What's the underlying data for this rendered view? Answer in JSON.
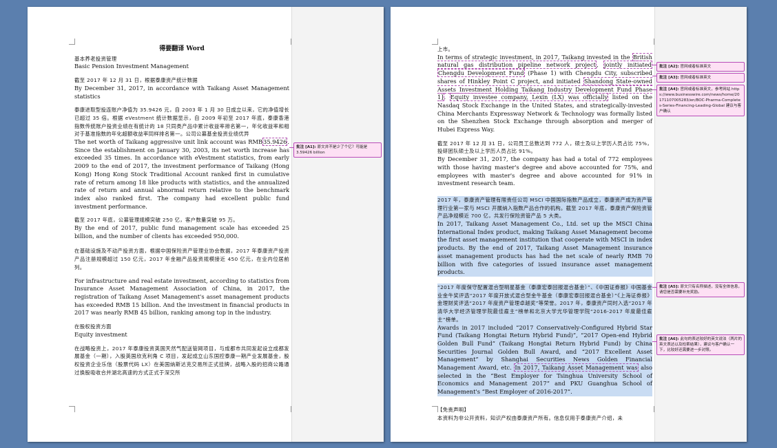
{
  "page1": {
    "title": "得要翻译 Word",
    "block1_cn": "基本养老投资管理",
    "block1_en": "Basic Pension Investment Management",
    "block2_cn": "截至 2017 年 12 月 31 日，根据泰康资产统计数据",
    "block2_en": "By December 31, 2017, in accordance with Taikang Asset Management statistics",
    "block3_cn": "泰康进取型投连账户净值为 35.9426 元，自 2003 年 1 月 30 日成立以来，它的净值增长已超过 35 倍。根据 eVestment 统计数据显示，自 2009 年初至 2017 年底，泰康香港指数传统账户投资业绩在有统计的 18 只同类产品中累计收益率排名第一，年化收益率和相对于基准指数的年化超额收益率同样排名第一。公司公募基金投资业绩优异",
    "block3_en_pre": "The net worth of Taikang aggressive unit link account was RMB",
    "block3_en_mark": "35.9426",
    "block3_en_post": ". Since the establishment on January 30, 2003, its net worth increase has exceeded 35 times. In accordance with eVestment statistics, from early 2009 to the end of 2017, the investment performance of Taikang (Hong Kong) Hong Kong Stock Traditional Account ranked first in cumulative rate of return among 18 like products with statistics, and the annualized rate of return and annual abnormal return relative to the benchmark index also ranked first. The company had excellent public fund investment performance.",
    "block4_cn": "截至 2017 年底，公募管理规模突破 250 亿，客户数量突破 95 万。",
    "block4_en": "By the end of 2017, public fund management scale has exceeded 25 billion, and the number of clients has exceeded 950,000.",
    "block5_cn": "在基础设施及不动产投资方面，根据中国保险资产管理业协会数据，2017 年泰康资产投资产品注册规模超过 150 亿元，2017 年金融产品投资规模接近 450 亿元，在业内位居前列。",
    "block5_en": "For infrastructure and real estate investment, according to statistics from Insurance Asset Management Association of China, in 2017, the registration of Taikang Asset Management's asset management products has exceeded RMB 15 billion. And the investment in financial products in 2017 was nearly RMB 45 billion, ranking among top in the industry.",
    "block6_cn": "在股权投资方面",
    "block6_en": "Equity investment",
    "block7_cn": "在战略投资上，2017 年泰康投资英国天然气配送管网项目，与成都市共同发起设立成都发展基金（一期），入股英国欣克利角 C 项目，发起成立山东国控泰康一期产业发展基金，股权投资企业乐信（股票代码 LX）在美国纳斯达克交易所正式挂牌，战略入股的招商公路通过换股吸收合并湖北高速的方式正式于深交所"
  },
  "page2": {
    "p1_cn": "上市。",
    "p1_en_a": "In terms of strategic investment, in 2017, Taikang invested in the ",
    "p1_en_mark1": "British natural gas distribution pipeline network project",
    "p1_en_b": ", ",
    "p1_en_mark2": "jointly initiated",
    "p1_en_c": " ",
    "p1_en_mark3": "Chengdu Development Fund",
    "p1_en_d": " (Phase 1) with Chengdu City, subscribed shares of Hinkley Point C project, and initiated ",
    "p1_en_mark4": "Shandong State-owned Assets Investment Holding Taikang Industry Development Fund Phase 1]",
    "p1_en_e": ". ",
    "p1_en_mark5": "Equity investee company, Lexin (LX) was officially",
    "p1_en_f": " listed on the Nasdaq Stock Exchange in the United States, and strategically-invested China Merchants Expressway Network & Technology was formally listed on the Shenzhen Stock Exchange through absorption and merger of Hubei Express Way.",
    "p2_cn": "截至 2017 年 12 月 31 日，公司员工总数达到 772 人，硕士及以上学历人员占比 75%，投研团队硕士及以上学历人员占比 91%。",
    "p2_en": "By December 31, 2017, the company has had a total of 772 employees with those having master's degree and above accounted for 75%, and employees with master's degree and above accounted for 91% in investment research team.",
    "p3_cn": "2017 年，泰康资产管理有限责任公司 MSCI 中国国际指数产品成立，泰康资产成为资产管理行业第一家与 MSCI 开展纳入指数产品合作的机构。截至 2017 年底，泰康资产保险资管产品净规模近 700 亿，共发行保险资管产品 5 大类。",
    "p3_en": "In 2017, Taikang Asset Management Co., Ltd. set up the MSCI China International Index product, making Taikang Asset Management become the first asset management institution that cooperate with MSCI in index products. By the end of 2017, Taikang Asset Management insurance asset management products has had the net scale of nearly RMB 70 billion with five categories of issued insurance asset management products.",
    "p4_cn": "“2017 年度保守配置混合型明星基金（泰康宏泰回报混合基金）”、《中国证券报》中国基金业金牛奖评选“2017 年度开放式混合型金牛基金（泰康宏泰回报混合基金）”《上海证券报》金理财奖评选“2017 年度资产管理卓越奖”等荣誉。2017 年，泰康资产同时入选“2017 年清华大学经济管理学院最佳雇主”榜单和北京大学光华管理学院“2016-2017 年度最佳雇主”榜单。",
    "p4_en_a": "Awards in 2017 included “2017 Conservatively-Configured Hybrid Star Fund (Taikang Hongtai Return Hybrid Fund)”, “2017 Open-end Hybrid Golden Bull Fund” (Taikang Hongtai Return Hybrid Fund) by China Securities Journal Golden Bull Award, and “2017 Excellent Asset Management” by Shanghai Securities News Golden Financial Management Award, etc. ",
    "p4_en_mark": "In 2017, Taikang Asset Management was",
    "p4_en_b": " also selected in the “Best Employer for Tsinghua University School of Economics and Management 2017” and PKU Guanghua School of Management's “Best Employer of 2016-2017”.",
    "disclaimer_title": "【免责声明】",
    "disclaimer_text": "本资料为非公开资料，知识产权由泰康资产所有。信息仅用于泰康资产介绍，未"
  },
  "comments": [
    {
      "label": "批注 [A1]:",
      "text": "原文并不是少了个亿？可能是 3.59426 billion"
    },
    {
      "label": "批注 [A2]:",
      "text": "官网或者标准英文"
    },
    {
      "label": "批注 [A3]:",
      "text": "官网或者标准英文"
    },
    {
      "label": "批注 [A4]:",
      "text": "官网或者标准英文，参考网站 https://www.businesswire.com/news/home/20171107005283/en/BOC-Pharma-Completes-Series-Financing-Leading-Global 建议与客户确认"
    },
    {
      "label": "批注 [A5]:",
      "text": "原文只有名称描述，没有全体信息，请您是否需要补充奖励。"
    },
    {
      "label": "批注 [A6]:",
      "text": "此句的表达较好的英文说法（两片的英文表达以及检索结果），建议与客户确认一下，比较好还需要进一步对照。"
    }
  ]
}
